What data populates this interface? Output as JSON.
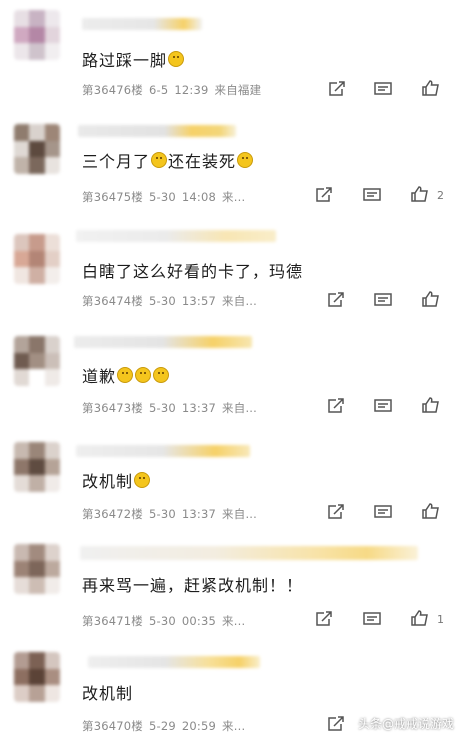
{
  "comments": [
    {
      "text": "路过踩一脚",
      "emojis_after": 1,
      "floor": "第36476楼",
      "date": "6-5",
      "time": "12:39",
      "source": "来自福建",
      "likes": ""
    },
    {
      "text": "三个月了",
      "mid_emoji": true,
      "text2": "还在装死",
      "emojis_after": 1,
      "floor": "第36475楼",
      "date": "5-30",
      "time": "14:08",
      "source": "来...",
      "likes": "2"
    },
    {
      "text": "白瞎了这么好看的卡了，玛德",
      "emojis_after": 0,
      "floor": "第36474楼",
      "date": "5-30",
      "time": "13:57",
      "source": "来自...",
      "likes": ""
    },
    {
      "text": "道歉",
      "emojis_after": 3,
      "floor": "第36473楼",
      "date": "5-30",
      "time": "13:37",
      "source": "来自...",
      "likes": ""
    },
    {
      "text": "改机制",
      "emojis_after": 1,
      "floor": "第36472楼",
      "date": "5-30",
      "time": "13:37",
      "source": "来自...",
      "likes": ""
    },
    {
      "text": "再来骂一遍，赶紧改机制！！",
      "emojis_after": 0,
      "floor": "第36471楼",
      "date": "5-30",
      "time": "00:35",
      "source": "来...",
      "likes": "1"
    },
    {
      "text": "改机制",
      "emojis_after": 0,
      "floor": "第36470楼",
      "date": "5-29",
      "time": "20:59",
      "source": "来...",
      "likes": ""
    }
  ],
  "watermark": "头条@戒戒说游戏",
  "colors": {
    "name_yellow": "#f6d168",
    "name_gray": "#dcdcdc",
    "meta": "#8a8a8a",
    "emoji": "#f4c51d"
  },
  "icons": [
    "share-icon",
    "reply-comment-icon",
    "thumbs-up-icon"
  ]
}
